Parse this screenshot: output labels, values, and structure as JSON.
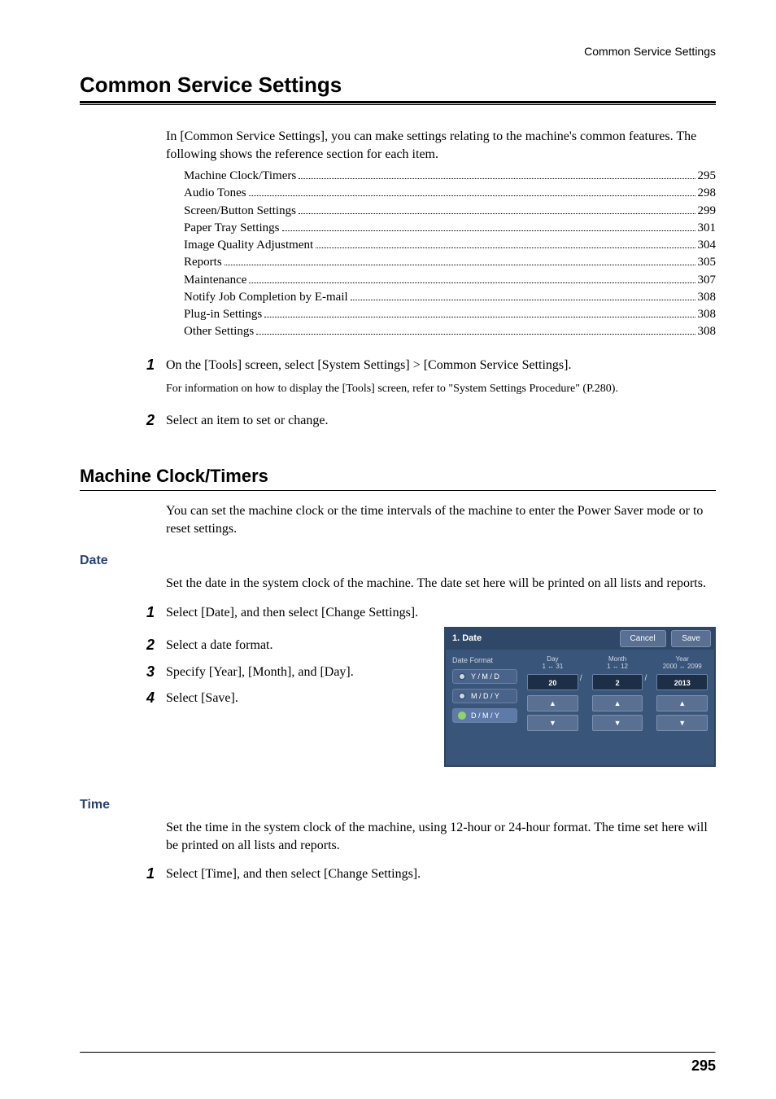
{
  "header": {
    "running_head": "Common Service Settings"
  },
  "section": {
    "title": "Common Service Settings",
    "intro": "In [Common Service Settings], you can make settings relating to the machine's common features. The following shows the reference section for each item."
  },
  "toc": [
    {
      "label": "Machine Clock/Timers",
      "page": "295"
    },
    {
      "label": "Audio Tones",
      "page": "298"
    },
    {
      "label": "Screen/Button Settings",
      "page": "299"
    },
    {
      "label": "Paper Tray Settings",
      "page": "301"
    },
    {
      "label": "Image Quality Adjustment",
      "page": "304"
    },
    {
      "label": "Reports",
      "page": "305"
    },
    {
      "label": "Maintenance",
      "page": "307"
    },
    {
      "label": "Notify Job Completion by E-mail",
      "page": "308"
    },
    {
      "label": "Plug-in Settings",
      "page": "308"
    },
    {
      "label": "Other Settings",
      "page": "308"
    }
  ],
  "steps_main": {
    "s1": "On the [Tools] screen, select [System Settings] > [Common Service Settings].",
    "s1_note": "For information on how to display the [Tools] screen, refer to \"System Settings Procedure\" (P.280).",
    "s2": "Select an item to set or change."
  },
  "subsection": {
    "title": "Machine Clock/Timers",
    "intro": "You can set the machine clock or the time intervals of the machine to enter the Power Saver mode or to reset settings."
  },
  "date": {
    "title": "Date",
    "intro": "Set the date in the system clock of the machine. The date set here will be printed on all lists and reports.",
    "s1": "Select [Date], and then select [Change Settings].",
    "s2": "Select a date format.",
    "s3": "Specify [Year], [Month], and [Day].",
    "s4": "Select [Save]."
  },
  "time": {
    "title": "Time",
    "intro": "Set the time in the system clock of the machine, using 12-hour or 24-hour format. The time set here will be printed on all lists and reports.",
    "s1": "Select [Time], and then select [Change Settings]."
  },
  "ui": {
    "title": "1. Date",
    "cancel": "Cancel",
    "save": "Save",
    "format_label": "Date Format",
    "fmt1": "Y / M / D",
    "fmt2": "M / D / Y",
    "fmt3": "D / M / Y",
    "day_label": "Day\n1 ↔ 31",
    "month_label": "Month\n1 ↔ 12",
    "year_label": "Year\n2000 ↔ 2099",
    "day_val": "20",
    "month_val": "2",
    "year_val": "2013",
    "slash": "/",
    "up": "▲",
    "down": "▼"
  },
  "page_number": "295",
  "nums": {
    "n1": "1",
    "n2": "2",
    "n3": "3",
    "n4": "4"
  }
}
